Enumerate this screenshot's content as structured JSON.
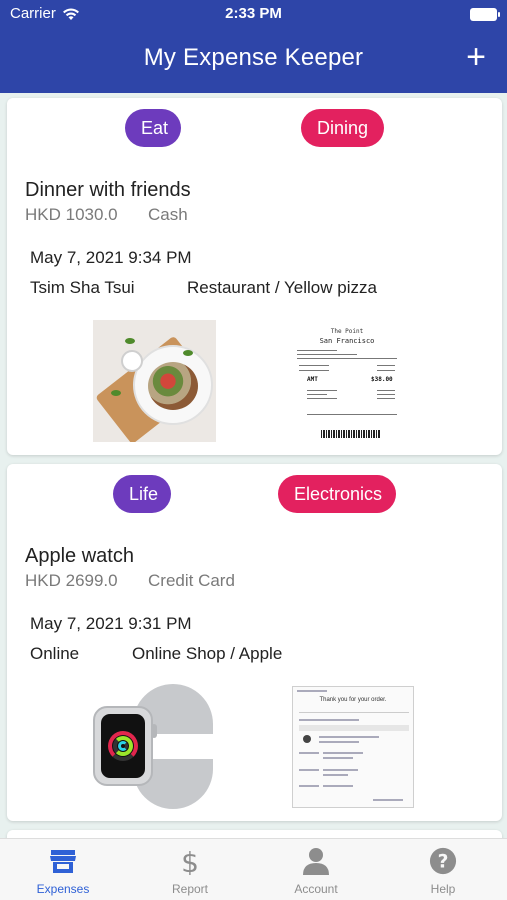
{
  "status_bar": {
    "carrier": "Carrier",
    "time": "2:33 PM"
  },
  "header": {
    "title": "My Expense Keeper",
    "add_icon": "plus-icon",
    "add_label": "+"
  },
  "expenses": [
    {
      "tags": [
        {
          "label": "Eat",
          "color": "#6d3bbd"
        },
        {
          "label": "Dining",
          "color": "#e3215f"
        }
      ],
      "title": "Dinner with friends",
      "amount": "HKD 1030.0",
      "payment": "Cash",
      "datetime": "May 7, 2021 9:34 PM",
      "location": "Tsim Sha Tsui",
      "merchant": "Restaurant / Yellow pizza",
      "images": [
        "food-photo",
        "receipt-photo"
      ]
    },
    {
      "tags": [
        {
          "label": "Life",
          "color": "#6d3bbd"
        },
        {
          "label": "Electronics",
          "color": "#e3215f"
        }
      ],
      "title": "Apple watch",
      "amount": "HKD 2699.0",
      "payment": "Credit Card",
      "datetime": "May 7, 2021 9:31 PM",
      "location": "Online",
      "merchant": "Online Shop / Apple",
      "images": [
        "watch-photo",
        "order-receipt-photo"
      ]
    }
  ],
  "receipt1": {
    "name": "The Point",
    "city": "San Francisco",
    "amt_label": "AMT",
    "amt_value": "$38.00"
  },
  "receipt2": {
    "heading": "Thank you for your order."
  },
  "tabbar": {
    "tabs": [
      {
        "label": "Expenses",
        "icon": "store-icon",
        "active": true
      },
      {
        "label": "Report",
        "icon": "dollar-icon",
        "active": false
      },
      {
        "label": "Account",
        "icon": "person-icon",
        "active": false
      },
      {
        "label": "Help",
        "icon": "question-icon",
        "active": false
      }
    ]
  },
  "colors": {
    "header": "#2e45a8",
    "accent": "#2f61d6",
    "tag_primary": "#6d3bbd",
    "tag_secondary": "#e3215f"
  }
}
